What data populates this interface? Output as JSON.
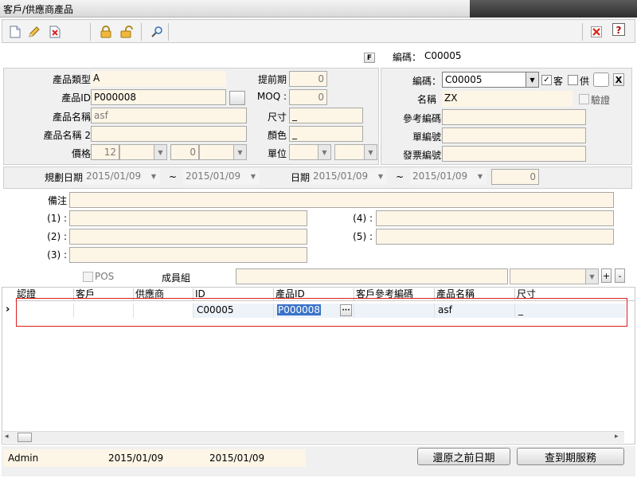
{
  "window": {
    "title": "客戶/供應商產品"
  },
  "header": {
    "f_badge": "F",
    "code_label": "編碼：",
    "code_value": "C00005"
  },
  "product": {
    "type_label": "產品類型",
    "type_value": "A",
    "id_label": "產品ID",
    "id_value": "P000008",
    "name_label": "產品名稱",
    "name_value": "asf",
    "name2_label": "產品名稱 2",
    "name2_value": "",
    "price_label": "價格",
    "price_value": "12",
    "price_value2": "0",
    "leadtime_label": "提前期",
    "leadtime_value": "0",
    "moq_label": "MOQ :",
    "moq_value": "0",
    "size_label": "尺寸",
    "size_value": "_",
    "color_label": "顏色",
    "color_value": "_",
    "unit_label": "單位"
  },
  "partner": {
    "code_label": "編碼：",
    "code_value": "C00005",
    "customer_label": "客",
    "customer_checked": true,
    "supplier_label": "供",
    "supplier_checked": false,
    "x_button": "X",
    "name_label": "名稱",
    "name_value": "ZX",
    "verify_label": "驗證",
    "ref_code_label": "參考編碼",
    "doc_no_label": "單編號",
    "invoice_no_label": "發票編號"
  },
  "dates": {
    "plan_label": "規劃日期",
    "plan_from": "2015/01/09",
    "tilde": "~",
    "plan_to": "2015/01/09",
    "date_label": "日期",
    "date_from": "2015/01/09",
    "date_to": "2015/01/09",
    "count_value": "0"
  },
  "notes": {
    "remark_label": "備注",
    "n1_label": "(1) :",
    "n2_label": "(2) :",
    "n3_label": "(3) :",
    "n4_label": "(4) :",
    "n5_label": "(5) :",
    "pos_label": "POS",
    "group_label": "成員組",
    "plus": "+",
    "minus": "-"
  },
  "grid": {
    "columns": [
      "認證",
      "客戶",
      "供應商",
      "ID",
      "產品ID",
      "客戶參考編碼",
      "產品名稱",
      "尺寸"
    ],
    "rows": [
      {
        "id": "C00005",
        "product_id": "P000008",
        "ellipsis": "···",
        "product_name": "asf",
        "size": "_"
      }
    ],
    "row_marker": "›"
  },
  "status": {
    "user": "Admin",
    "date1": "2015/01/09",
    "date2": "2015/01/09",
    "restore_button": "還原之前日期",
    "expiry_button": "查到期服務"
  },
  "icons": {
    "new": "new-document-icon",
    "edit": "pencil-icon",
    "delete": "delete-icon",
    "lock": "lock-icon",
    "unlock": "unlock-icon",
    "search": "search-icon",
    "close": "close-icon",
    "help": "help-icon"
  }
}
